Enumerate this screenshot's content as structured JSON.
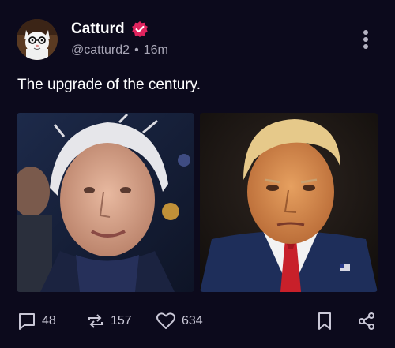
{
  "author": {
    "display_name": "Catturd",
    "handle": "@catturd2",
    "separator": "•",
    "time_ago": "16m",
    "verified": true
  },
  "post": {
    "text": "The upgrade of the century."
  },
  "images": [
    {
      "alt": "photo-left"
    },
    {
      "alt": "photo-right"
    }
  ],
  "actions": {
    "reply_count": "48",
    "repost_count": "157",
    "like_count": "634"
  },
  "colors": {
    "background": "#0c0a1c",
    "verified_badge": "#e0245e",
    "secondary_text": "#a8a6b6"
  },
  "icons": {
    "more": "more-vertical-icon",
    "reply": "reply-icon",
    "repost": "repost-icon",
    "like": "heart-icon",
    "save": "bookmark-icon",
    "share": "share-icon",
    "verified": "verified-badge-icon"
  }
}
